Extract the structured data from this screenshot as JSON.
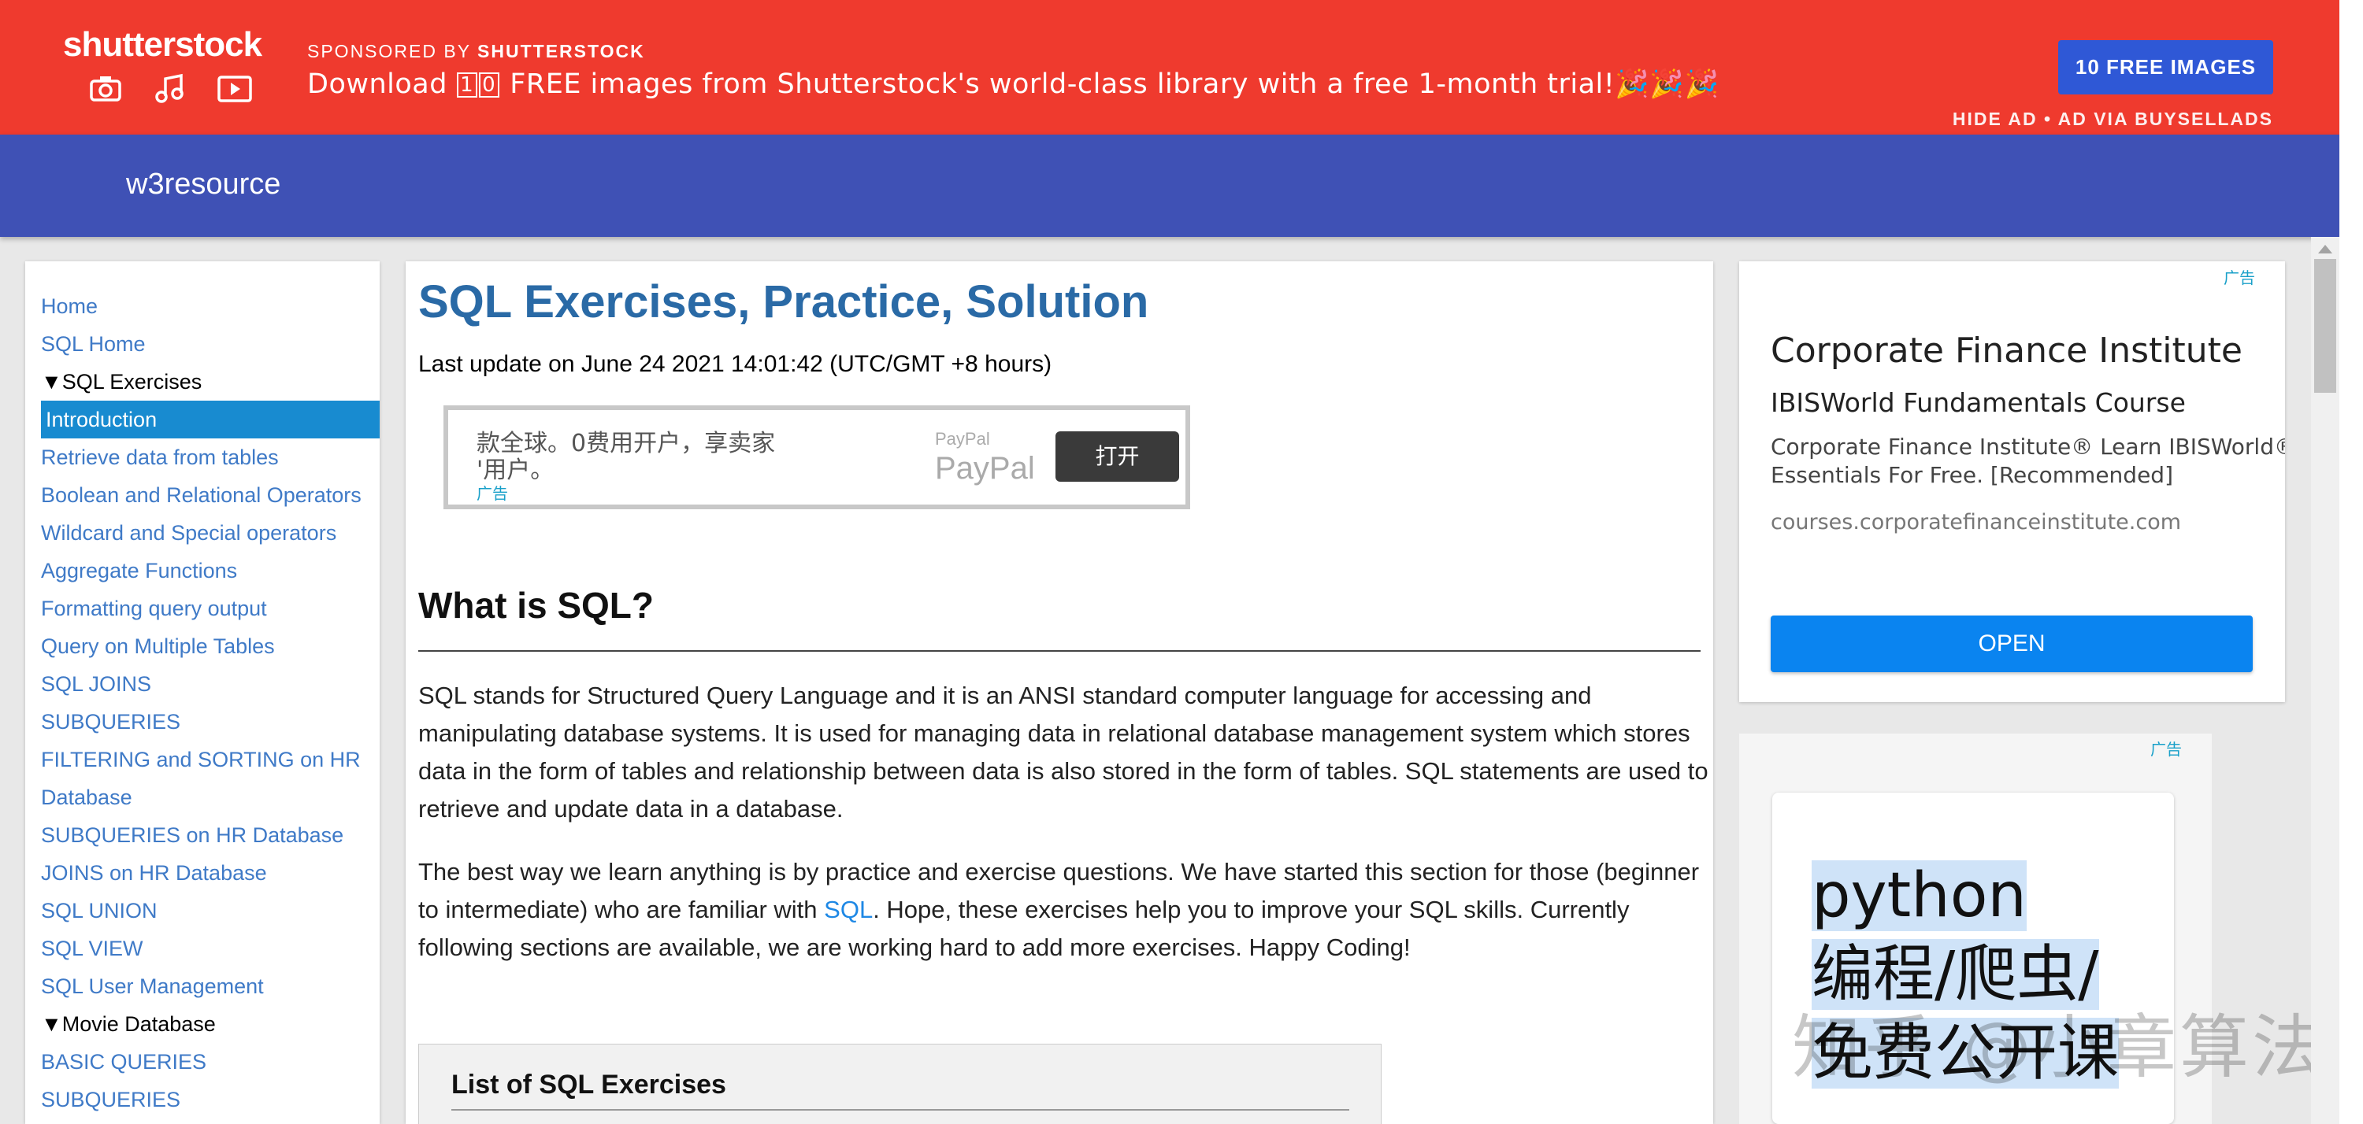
{
  "banner": {
    "logo": "shutterstock",
    "sponsored_prefix": "SPONSORED BY",
    "sponsored_name": "SHUTTERSTOCK",
    "text_before": "Download",
    "digit1": "1",
    "digit2": "0",
    "text_after": " FREE images from Shutterstock's world-class library with a free 1-month trial!🎉🎉🎉",
    "cta": "10 FREE IMAGES",
    "hide_ad": "HIDE AD • AD VIA BUYSELLADS",
    "icons": [
      "camera-icon",
      "music-note-icon",
      "video-play-icon"
    ]
  },
  "header": {
    "site_name": "w3resource"
  },
  "sidebar": {
    "items": [
      {
        "label": "Home",
        "type": "link"
      },
      {
        "label": "SQL Home",
        "type": "link"
      },
      {
        "label": "▼SQL Exercises",
        "type": "section"
      },
      {
        "label": "Introduction",
        "type": "active"
      },
      {
        "label": "Retrieve data from tables",
        "type": "link"
      },
      {
        "label": "Boolean and Relational Operators",
        "type": "link"
      },
      {
        "label": "Wildcard and Special operators",
        "type": "link"
      },
      {
        "label": "Aggregate Functions",
        "type": "link"
      },
      {
        "label": "Formatting query output",
        "type": "link"
      },
      {
        "label": "Query on Multiple Tables",
        "type": "link"
      },
      {
        "label": "SQL JOINS",
        "type": "link"
      },
      {
        "label": "SUBQUERIES",
        "type": "link"
      },
      {
        "label": "FILTERING and SORTING on HR",
        "type": "link"
      },
      {
        "label": "Database",
        "type": "link"
      },
      {
        "label": "SUBQUERIES on HR Database",
        "type": "link"
      },
      {
        "label": "JOINS on HR Database",
        "type": "link"
      },
      {
        "label": "SQL UNION",
        "type": "link"
      },
      {
        "label": "SQL VIEW",
        "type": "link"
      },
      {
        "label": "SQL User Management",
        "type": "link"
      },
      {
        "label": "▼Movie Database",
        "type": "section"
      },
      {
        "label": "BASIC QUERIES",
        "type": "link"
      },
      {
        "label": "SUBQUERIES",
        "type": "link"
      }
    ]
  },
  "main": {
    "title": "SQL Exercises, Practice, Solution",
    "last_update": "Last update on June 24 2021 14:01:42 (UTC/GMT +8 hours)",
    "paypal_ad": {
      "line1": "款全球。0费用开户，享卖家",
      "line2": "'用户。",
      "ad_tag": "广告",
      "brand_small": "PayPal",
      "brand_large": "PayPal",
      "button": "打开"
    },
    "heading": "What is SQL?",
    "para1": "SQL stands for Structured Query Language and it is an ANSI standard computer language for accessing and manipulating database systems. It is used for managing data in relational database management system which stores data in the form of tables and relationship between data is also stored in the form of tables. SQL statements are used to retrieve and update data in a database.",
    "para2_before": "The best way we learn anything is by practice and exercise questions. We have started this section for those (beginner to intermediate) who are familiar with ",
    "para2_link": "SQL",
    "para2_after": ". Hope, these exercises help you to improve your SQL skills. Currently following sections are available, we are working hard to add more exercises. Happy Coding!",
    "list_title": "List of SQL Exercises"
  },
  "right_ad1": {
    "ad_tag": "广告",
    "title": "Corporate Finance Institute",
    "subtitle": "IBISWorld Fundamentals Course",
    "desc_line1": "Corporate Finance Institute® Learn IBISWorld®",
    "desc_line2": "Essentials For Free. [Recommended]",
    "url": "courses.corporatefinanceinstitute.com",
    "button": "OPEN"
  },
  "right_ad2": {
    "ad_tag": "广告",
    "line1": "python",
    "line2": "编程/爬虫/",
    "line3": "免费公开课"
  },
  "watermark": "知乎 @小章算法"
}
